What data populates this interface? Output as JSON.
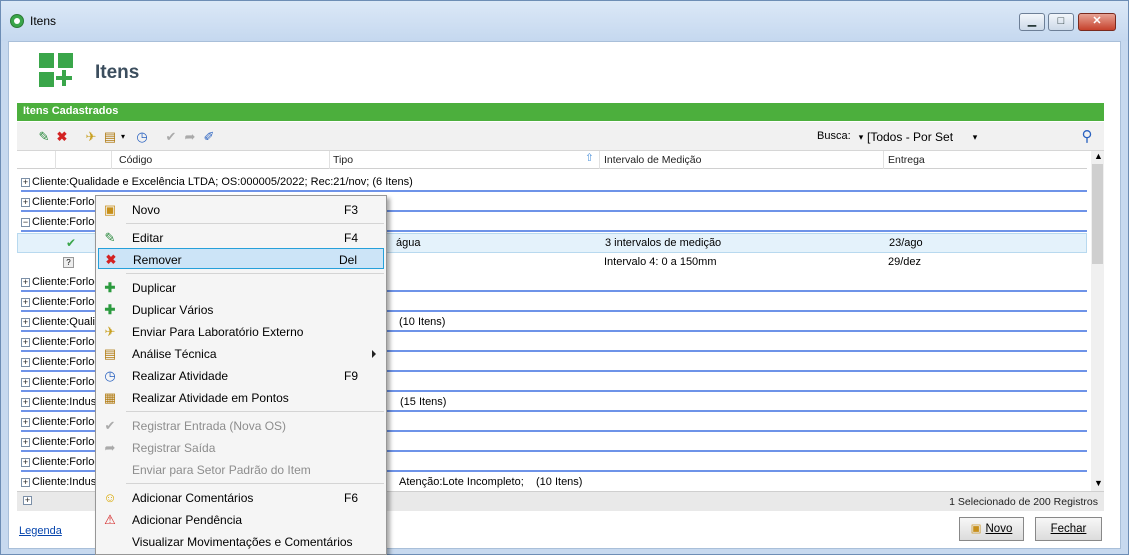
{
  "window": {
    "title": "Itens",
    "minimize": "▁",
    "maximize": "□",
    "close": "✕"
  },
  "header": {
    "title": "Itens"
  },
  "panel": {
    "title": "Itens Cadastrados"
  },
  "toolbar": {
    "busca_label": "Busca:",
    "busca_value": "[Todos - Por Set"
  },
  "grid": {
    "columns": [
      "Código",
      "Tipo",
      "Intervalo de Medição",
      "Entrega"
    ],
    "rows": [
      "Cliente:Qualidade e Excelência LTDA;   OS:000005/2022;   Rec:21/nov;   (6 Itens)",
      "Cliente:Forlog",
      "Cliente:Forlog",
      "Cliente:Forlog",
      "Cliente:Forlog",
      "Cliente:Qualic",
      "Cliente:Forlog",
      "Cliente:Forlog",
      "Cliente:Forlog",
      "Cliente:Indust",
      "Cliente:Forlog",
      "Cliente:Forlog",
      "Cliente:Forlog",
      "Cliente:Indust"
    ],
    "row_tails": {
      "r5": "(10 Itens)",
      "r9": "(15 Itens)",
      "r13a": "Atenção:Lote Incompleto;",
      "r13b": "(10 Itens)"
    },
    "sub1": {
      "tipo": "água",
      "intervalo": "3 intervalos de medição",
      "entrega": "23/ago"
    },
    "sub2": {
      "intervalo": "Intervalo 4: 0 a 150mm",
      "entrega": "29/dez"
    }
  },
  "status": {
    "text": "1 Selecionado de 200 Registros"
  },
  "footer": {
    "legend": "Legenda",
    "novo": "Novo",
    "fechar": "Fechar"
  },
  "menu": [
    {
      "label": "Novo",
      "shortcut": "F3"
    },
    {
      "label": "Editar",
      "shortcut": "F4"
    },
    {
      "label": "Remover",
      "shortcut": "Del"
    },
    {
      "label": "Duplicar",
      "shortcut": ""
    },
    {
      "label": "Duplicar Vários",
      "shortcut": ""
    },
    {
      "label": "Enviar Para Laboratório Externo",
      "shortcut": ""
    },
    {
      "label": "Análise Técnica",
      "shortcut": ""
    },
    {
      "label": "Realizar Atividade",
      "shortcut": "F9"
    },
    {
      "label": "Realizar Atividade em Pontos",
      "shortcut": ""
    },
    {
      "label": "Registrar Entrada (Nova OS)",
      "shortcut": ""
    },
    {
      "label": "Registrar Saída",
      "shortcut": ""
    },
    {
      "label": "Enviar para Setor Padrão do Item",
      "shortcut": ""
    },
    {
      "label": "Adicionar Comentários",
      "shortcut": "F6"
    },
    {
      "label": "Adicionar Pendência",
      "shortcut": ""
    },
    {
      "label": "Visualizar Movimentações e Comentários",
      "shortcut": ""
    }
  ],
  "colors": {
    "accent_green": "#4caf3d",
    "selection": "#cce4f7",
    "row_line": "#6e93e8"
  }
}
